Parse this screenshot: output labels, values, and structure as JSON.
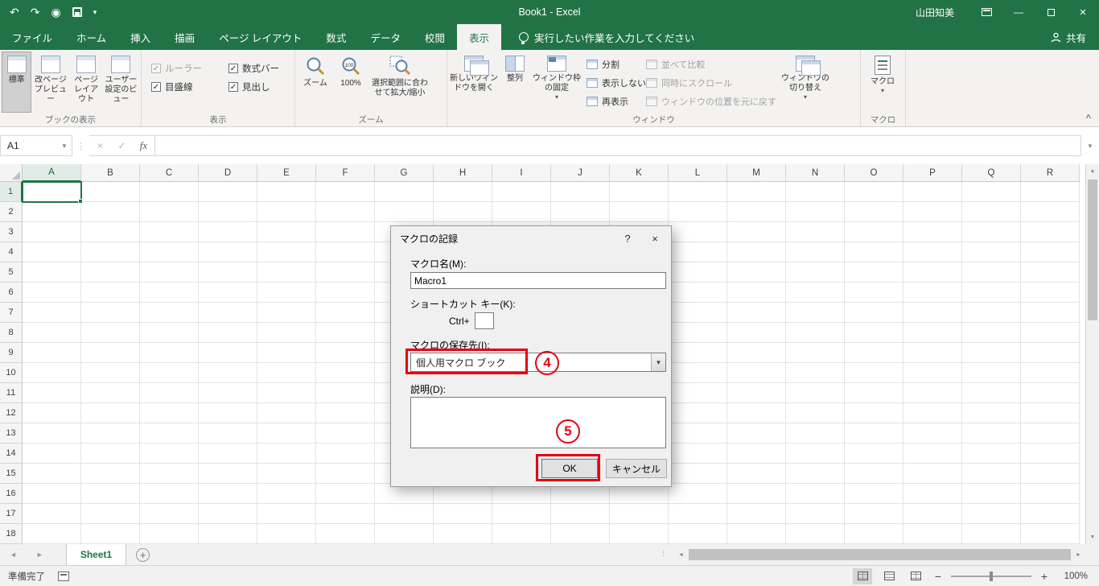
{
  "colors": {
    "excel_green": "#217346",
    "annotation_red": "#e60012",
    "ribbon_bg": "#f3f2f1"
  },
  "icons": {
    "undo": "↶",
    "redo": "↷",
    "touch": "◉",
    "customize": "▾",
    "dropdown": "▾",
    "minimize": "—",
    "close": "×",
    "help": "?",
    "cancel_x": "×",
    "check": "✓",
    "fx": "fx",
    "nav_left": "◄",
    "nav_right": "►",
    "up": "▲",
    "down": "▼",
    "collapse": "^",
    "handle": "⋮",
    "minus": "−",
    "plus": "+",
    "add": "+"
  },
  "titlebar": {
    "title": "Book1  -  Excel",
    "user": "山田知美"
  },
  "tabs": {
    "items": [
      {
        "id": "file",
        "label": "ファイル",
        "active": false
      },
      {
        "id": "home",
        "label": "ホーム",
        "active": false
      },
      {
        "id": "insert",
        "label": "挿入",
        "active": false
      },
      {
        "id": "draw",
        "label": "描画",
        "active": false
      },
      {
        "id": "page-layout",
        "label": "ページ レイアウト",
        "active": false
      },
      {
        "id": "formulas",
        "label": "数式",
        "active": false
      },
      {
        "id": "data",
        "label": "データ",
        "active": false
      },
      {
        "id": "review",
        "label": "校閲",
        "active": false
      },
      {
        "id": "view",
        "label": "表示",
        "active": true
      }
    ],
    "search": "実行したい作業を入力してください",
    "share": "共有"
  },
  "ribbon": {
    "views": {
      "label": "ブックの表示",
      "normal": "標準",
      "page_break": "改ページ プレビュー",
      "page_layout": "ページ レイアウト",
      "custom": "ユーザー設定のビュー"
    },
    "show": {
      "label": "表示",
      "ruler": "ルーラー",
      "formula_bar": "数式バー",
      "gridlines": "目盛線",
      "headings": "見出し"
    },
    "zoom": {
      "label": "ズーム",
      "zoom": "ズーム",
      "hundred": "100%",
      "fit": "選択範囲に合わせて拡大/縮小"
    },
    "window": {
      "label": "ウィンドウ",
      "new_window": "新しいウィンドウを開く",
      "arrange": "整列",
      "freeze": "ウィンドウ枠の固定",
      "split": "分割",
      "hide": "表示しない",
      "unhide": "再表示",
      "side_by_side": "並べて比較",
      "sync_scroll": "同時にスクロール",
      "reset_position": "ウィンドウの位置を元に戻す",
      "switch": "ウィンドウの切り替え"
    },
    "macros": {
      "label": "マクロ",
      "button": "マクロ"
    }
  },
  "formula_bar": {
    "name_box": "A1",
    "value": ""
  },
  "grid": {
    "columns": [
      "A",
      "B",
      "C",
      "D",
      "E",
      "F",
      "G",
      "H",
      "I",
      "J",
      "K",
      "L",
      "M",
      "N",
      "O",
      "P",
      "Q",
      "R"
    ],
    "rows": [
      "1",
      "2",
      "3",
      "4",
      "5",
      "6",
      "7",
      "8",
      "9",
      "10",
      "11",
      "12",
      "13",
      "14",
      "15",
      "16",
      "17",
      "18"
    ],
    "selected_cell": "A1",
    "selected_col": "A",
    "selected_row": "1"
  },
  "dialog": {
    "title": "マクロの記録",
    "name_label": "マクロ名(M):",
    "name_value": "Macro1",
    "shortcut_label": "ショートカット キー(K):",
    "shortcut_prefix": "Ctrl+",
    "shortcut_value": "",
    "store_label": "マクロの保存先(I):",
    "store_value": "個人用マクロ ブック",
    "desc_label": "説明(D):",
    "desc_value": "",
    "ok": "OK",
    "cancel": "キャンセル"
  },
  "annotations": {
    "step4": "4",
    "step5": "5"
  },
  "sheetbar": {
    "sheet": "Sheet1"
  },
  "statusbar": {
    "ready": "準備完了",
    "zoom": "100%"
  }
}
